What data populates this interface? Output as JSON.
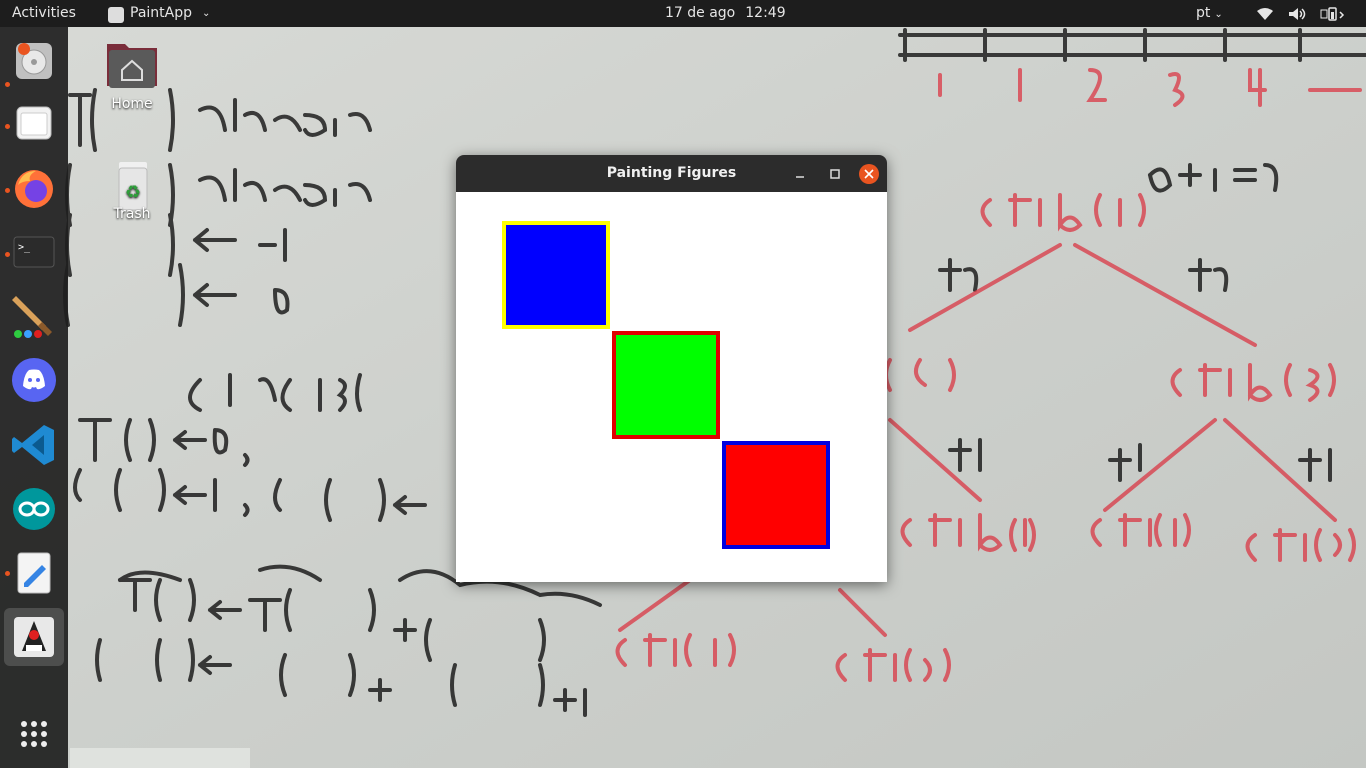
{
  "topbar": {
    "activities": "Activities",
    "app_name": "PaintApp",
    "date": "17 de ago",
    "time": "12:49",
    "language": "pt"
  },
  "desktop": {
    "icons": [
      {
        "label": "Home",
        "icon": "home-folder-icon"
      },
      {
        "label": "Trash",
        "icon": "trash-icon"
      }
    ]
  },
  "dock": {
    "items": [
      {
        "name": "disk-installer",
        "running": true
      },
      {
        "name": "files",
        "running": true
      },
      {
        "name": "firefox",
        "running": true
      },
      {
        "name": "terminal",
        "running": true
      },
      {
        "name": "paint-brush-app",
        "running": false
      },
      {
        "name": "discord",
        "running": false
      },
      {
        "name": "vscode",
        "running": false
      },
      {
        "name": "arduino",
        "running": false
      },
      {
        "name": "text-editor",
        "running": true
      },
      {
        "name": "java-duke",
        "running": true,
        "active": true
      },
      {
        "name": "show-applications",
        "running": false
      }
    ]
  },
  "window": {
    "title": "Painting Figures",
    "shapes": [
      {
        "name": "blue-square",
        "fill": "#0000ff",
        "border": "#ffff00"
      },
      {
        "name": "green-square",
        "fill": "#00ff00",
        "border": "#e00000"
      },
      {
        "name": "red-square",
        "fill": "#ff0000",
        "border": "#0000e0"
      }
    ]
  },
  "colors": {
    "accent": "#e95420",
    "topbar_bg": "#1d1d1d",
    "titlebar_bg": "#2c2c2c"
  }
}
